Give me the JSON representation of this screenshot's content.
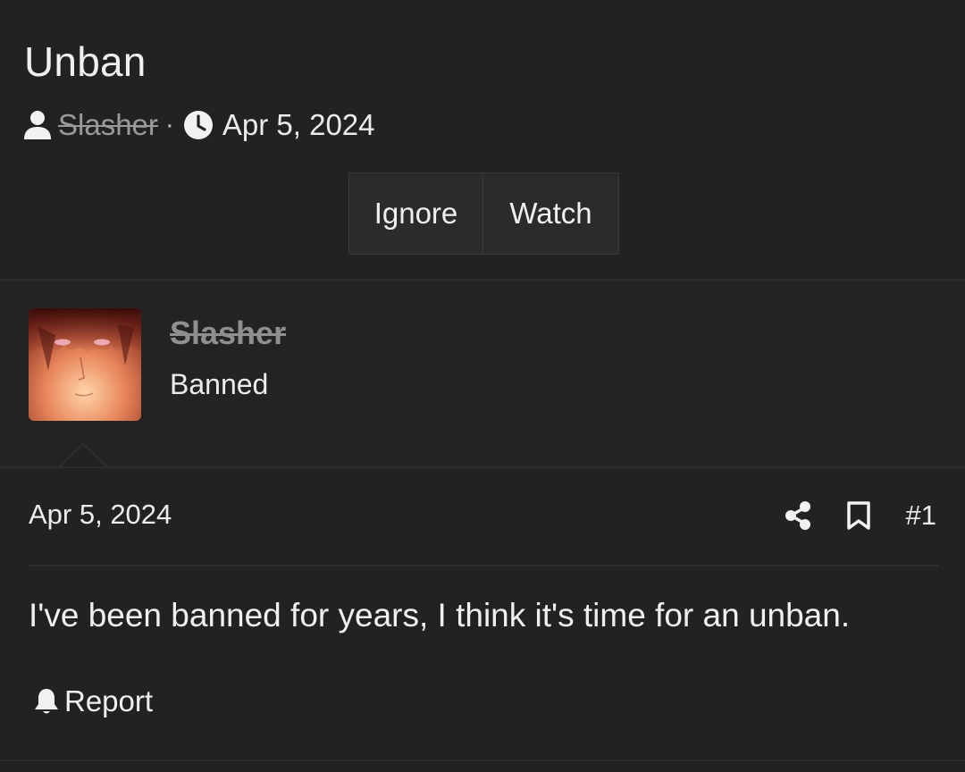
{
  "thread": {
    "title": "Unban",
    "author": "Slasher",
    "separator": "·",
    "date": "Apr 5, 2024"
  },
  "actions": {
    "ignore_label": "Ignore",
    "watch_label": "Watch"
  },
  "message": {
    "username": "Slasher",
    "user_title": "Banned",
    "date": "Apr 5, 2024",
    "post_number": "#1",
    "body": "I've been banned for years, I think it's time for an unban.",
    "report_label": "Report"
  },
  "icons": {
    "author": "user-icon",
    "date": "clock-icon",
    "share": "share-icon",
    "bookmark": "bookmark-icon",
    "report": "bell-icon"
  },
  "colors": {
    "background": "#222222",
    "text": "#ececec",
    "banned_username": "#8f8f8f",
    "button_bg": "#2b2b2b",
    "border": "#3a3a3a"
  }
}
